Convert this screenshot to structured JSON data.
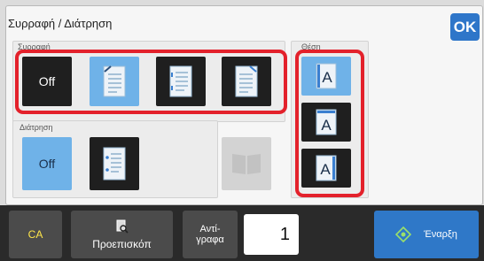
{
  "header": {
    "title": "Συρραφή / Διάτρηση",
    "ok_label": "OK"
  },
  "staple": {
    "label": "Συρραφή",
    "off_label": "Off",
    "options": [
      {
        "name": "staple-off",
        "selected": false
      },
      {
        "name": "staple-top-left",
        "selected": true
      },
      {
        "name": "staple-left-double",
        "selected": false
      },
      {
        "name": "staple-top-right",
        "selected": false
      }
    ]
  },
  "punch": {
    "label": "Διάτρηση",
    "off_label": "Off",
    "selected": "off"
  },
  "position": {
    "label": "Θέση",
    "glyph": "A",
    "options": [
      {
        "name": "position-left",
        "selected": true
      },
      {
        "name": "position-top",
        "selected": false
      },
      {
        "name": "position-right",
        "selected": false
      }
    ]
  },
  "bottom": {
    "ca_label": "CA",
    "preview_label": "Προεπισκόπ",
    "copies_label_line1": "Αντί-",
    "copies_label_line2": "γραφα",
    "copies_value": "1",
    "start_label": "Έναρξη"
  },
  "colors": {
    "selected": "#6fb2e8",
    "unselected": "#1f1f1f",
    "highlight": "#e3212b",
    "ok": "#2e76c9",
    "start": "#2f78c8"
  }
}
